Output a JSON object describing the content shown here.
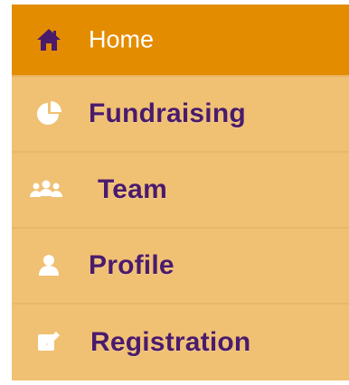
{
  "nav": {
    "items": [
      {
        "label": "Home",
        "icon": "home-icon",
        "active": true
      },
      {
        "label": "Fundraising",
        "icon": "pie-chart-icon",
        "active": false
      },
      {
        "label": "Team",
        "icon": "team-icon",
        "active": false
      },
      {
        "label": "Profile",
        "icon": "user-icon",
        "active": false
      },
      {
        "label": "Registration",
        "icon": "edit-icon",
        "active": false
      }
    ]
  },
  "colors": {
    "active_background": "#e48c00",
    "item_background": "#f0c073",
    "active_text": "#ffffff",
    "item_text": "#4a1b6b",
    "icon_active": "#4a1b6b",
    "icon_inactive": "#ffffff"
  }
}
